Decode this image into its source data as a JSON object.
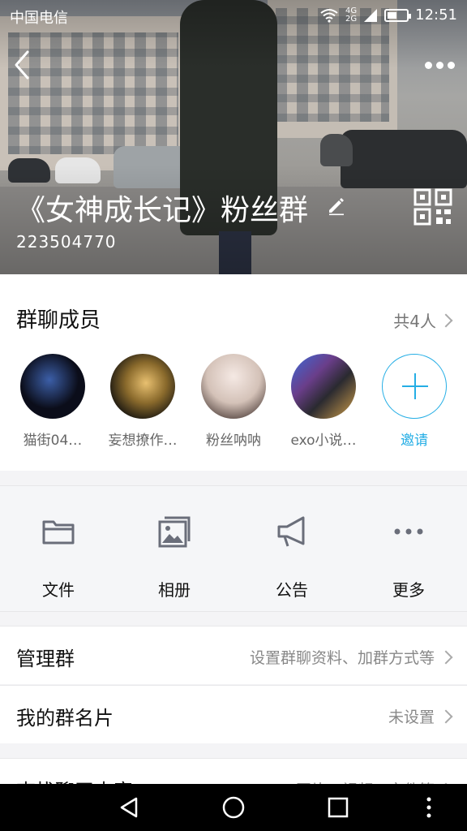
{
  "status_bar": {
    "carrier": "中国电信",
    "network": "4G",
    "network2": "2G",
    "time": "12:51"
  },
  "header": {
    "title": "《女神成长记》粉丝群",
    "group_id": "223504770"
  },
  "members": {
    "title": "群聊成员",
    "count_label": "共4人",
    "list": [
      {
        "name": "猫街04…",
        "avatar_colors": [
          "#0b0d1a",
          "#2a3a6a"
        ]
      },
      {
        "name": "妄想撩作…",
        "avatar_colors": [
          "#2a2214",
          "#c99a38"
        ]
      },
      {
        "name": "粉丝呐呐",
        "avatar_colors": [
          "#e9e4df",
          "#b69a8a"
        ]
      },
      {
        "name": "exo小说…",
        "avatar_colors": [
          "#3c3a48",
          "#6a6ac8"
        ]
      }
    ],
    "invite_label": "邀请",
    "accent": "#25aee5"
  },
  "tools": [
    {
      "label": "文件",
      "icon": "folder-icon"
    },
    {
      "label": "相册",
      "icon": "album-icon"
    },
    {
      "label": "公告",
      "icon": "megaphone-icon"
    },
    {
      "label": "更多",
      "icon": "more-dots-icon"
    }
  ],
  "rows": [
    {
      "label": "管理群",
      "value": "设置群聊资料、加群方式等"
    },
    {
      "label": "我的群名片",
      "value": "未设置"
    },
    {
      "label": "查找聊天内容",
      "value": "图片、视频、文件等"
    }
  ]
}
